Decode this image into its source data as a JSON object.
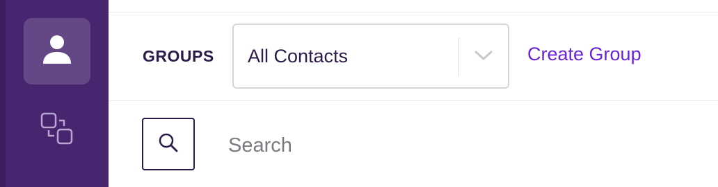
{
  "sidebar": {
    "items": [
      {
        "icon": "user-icon",
        "active": true
      },
      {
        "icon": "switch-account-icon",
        "active": false
      }
    ]
  },
  "groups": {
    "label": "GROUPS",
    "selected": "All Contacts",
    "create_label": "Create Group"
  },
  "search": {
    "placeholder": "Search",
    "value": ""
  },
  "colors": {
    "sidebar": "#47266f",
    "accent": "#6a23d6",
    "text_dark": "#2c1a4a"
  }
}
